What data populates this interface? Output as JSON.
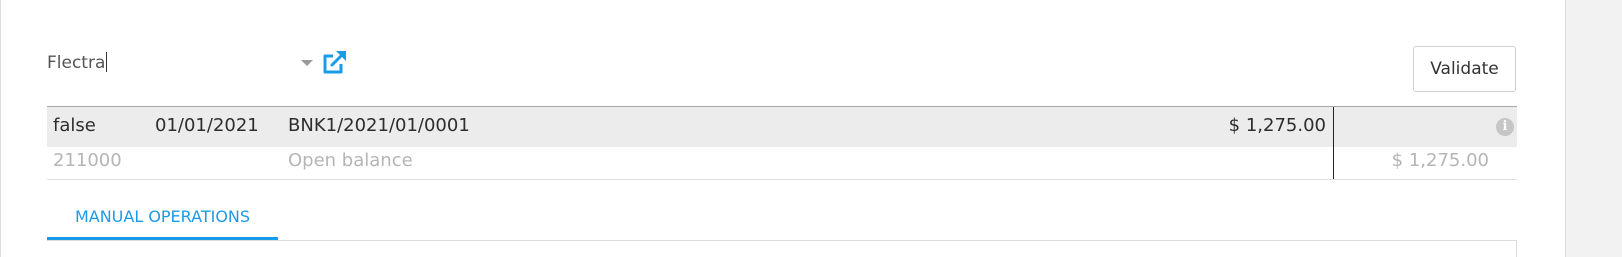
{
  "partner": {
    "value": "Flectra"
  },
  "buttons": {
    "validate_label": "Validate"
  },
  "statement_line": {
    "partner": "false",
    "date": "01/01/2021",
    "reference": "BNK1/2021/01/0001",
    "amount": "$ 1,275.00"
  },
  "proposition_line": {
    "account": "211000",
    "label": "Open balance",
    "amount": "$ 1,275.00"
  },
  "tabs": {
    "manual_operations": "MANUAL OPERATIONS"
  },
  "icons": {
    "external_link": "external-link-icon",
    "dropdown": "caret-down-icon",
    "info": "info-circle-icon",
    "info_glyph": "i"
  },
  "colors": {
    "accent": "#1a9be8",
    "row_highlight": "#ececec",
    "muted_text": "#b5b5b5"
  }
}
